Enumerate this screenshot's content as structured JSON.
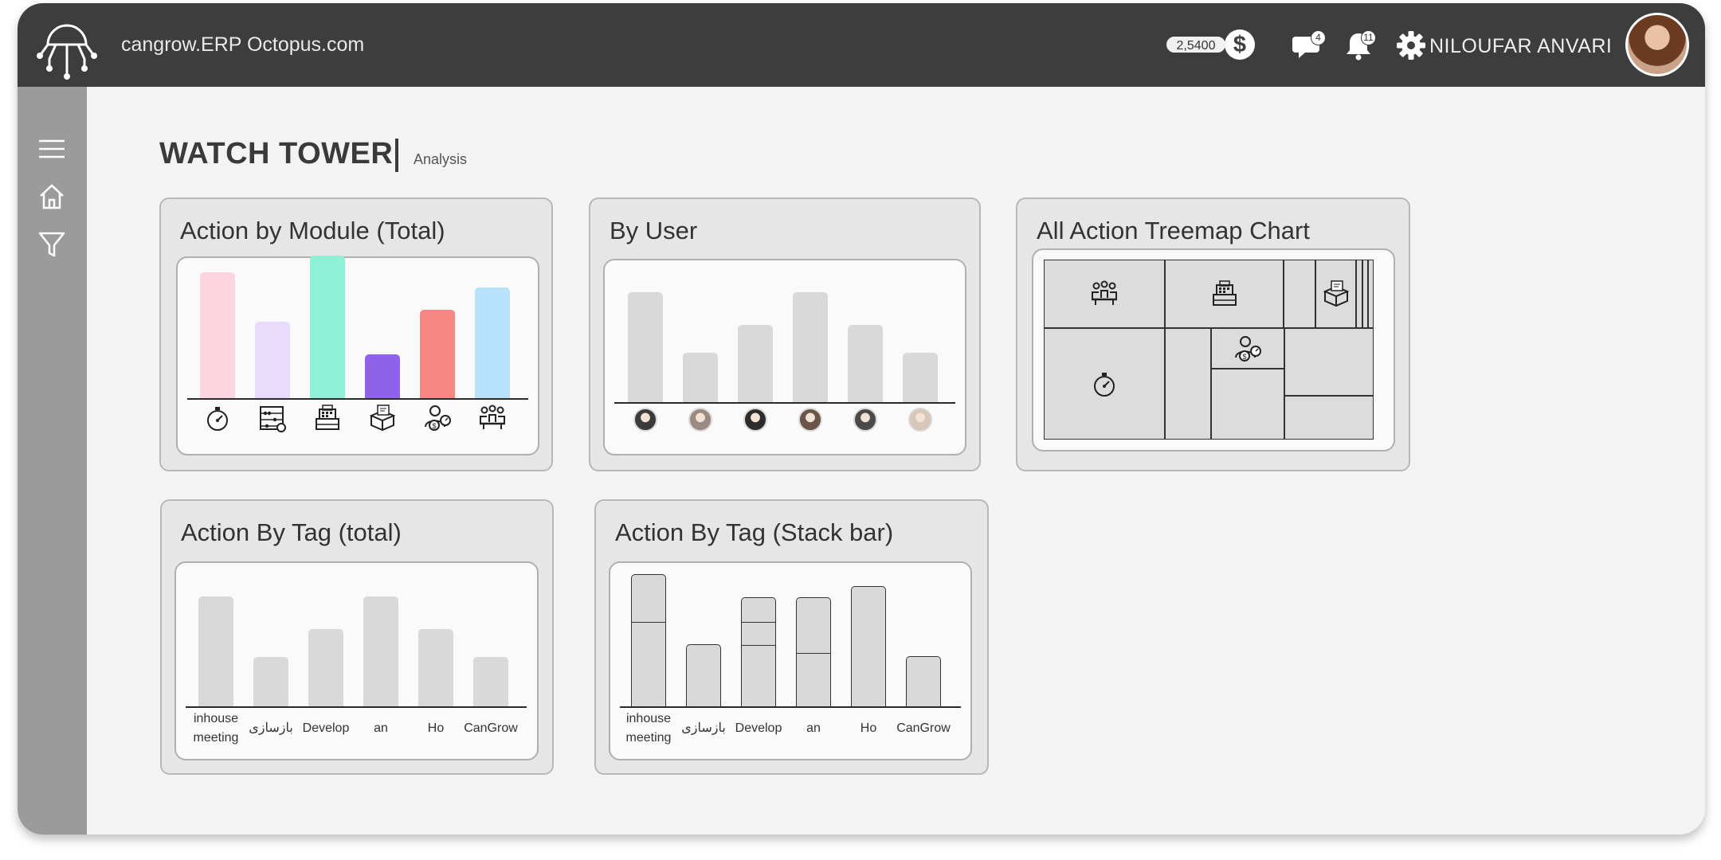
{
  "topbar": {
    "app_title": "cangrow.ERP Octopus.com",
    "coins": "2,5400",
    "messages_count": "4",
    "notifications_count": "11",
    "user_name": "NILOUFAR ANVARI"
  },
  "page": {
    "title": "WATCH TOWER",
    "subtitle": "Analysis"
  },
  "cards": {
    "module": {
      "title": "Action by Module (Total)"
    },
    "user": {
      "title": "By User"
    },
    "treemap": {
      "title": "All Action Treemap Chart"
    },
    "tag_total": {
      "title": "Action By Tag (total)"
    },
    "tag_stack": {
      "title": "Action By Tag (Stack bar)"
    }
  },
  "chart_data": [
    {
      "type": "bar",
      "id": "module",
      "categories": [
        "stopwatch-icon",
        "abacus-icon",
        "cash-register-icon",
        "box-icon",
        "user-money-icon",
        "meeting-icon"
      ],
      "values": [
        101,
        61,
        114,
        35,
        71,
        89
      ],
      "colors": [
        "#fdd5e0",
        "#e8dbfb",
        "#8ff0d6",
        "#9062ea",
        "#f98785",
        "#b6e2fb"
      ],
      "ylim": [
        0,
        120
      ]
    },
    {
      "type": "bar",
      "id": "user",
      "categories": [
        "user-1",
        "user-2",
        "user-3",
        "user-4",
        "user-5",
        "user-6"
      ],
      "values": [
        100,
        45,
        70,
        100,
        70,
        45
      ],
      "color": "#d9d9d9",
      "ylim": [
        0,
        110
      ]
    },
    {
      "type": "bar",
      "id": "tag_total",
      "categories": [
        "inhouse meeting",
        "بازسازی",
        "Develop",
        "an",
        "Ho",
        "CanGrow"
      ],
      "values": [
        100,
        45,
        70,
        100,
        70,
        45
      ],
      "color": "#d9d9d9",
      "ylim": [
        0,
        120
      ]
    },
    {
      "type": "bar",
      "id": "tag_stack",
      "stacked": true,
      "categories": [
        "inhouse meeting",
        "بازسازی",
        "Develop",
        "an",
        "Ho",
        "CanGrow"
      ],
      "stacks": [
        [
          79,
          43
        ],
        [
          57
        ],
        [
          57,
          22,
          22
        ],
        [
          50,
          51
        ],
        [
          111
        ],
        [
          46
        ]
      ],
      "color": "#d9d9d9",
      "ylim": [
        0,
        125
      ]
    },
    {
      "type": "treemap",
      "id": "treemap",
      "cells": [
        "meeting-icon",
        "cash-register-icon",
        "",
        "box-icon",
        "",
        "",
        "",
        "stopwatch-icon",
        "",
        "user-money-icon",
        "",
        "",
        ""
      ]
    }
  ]
}
